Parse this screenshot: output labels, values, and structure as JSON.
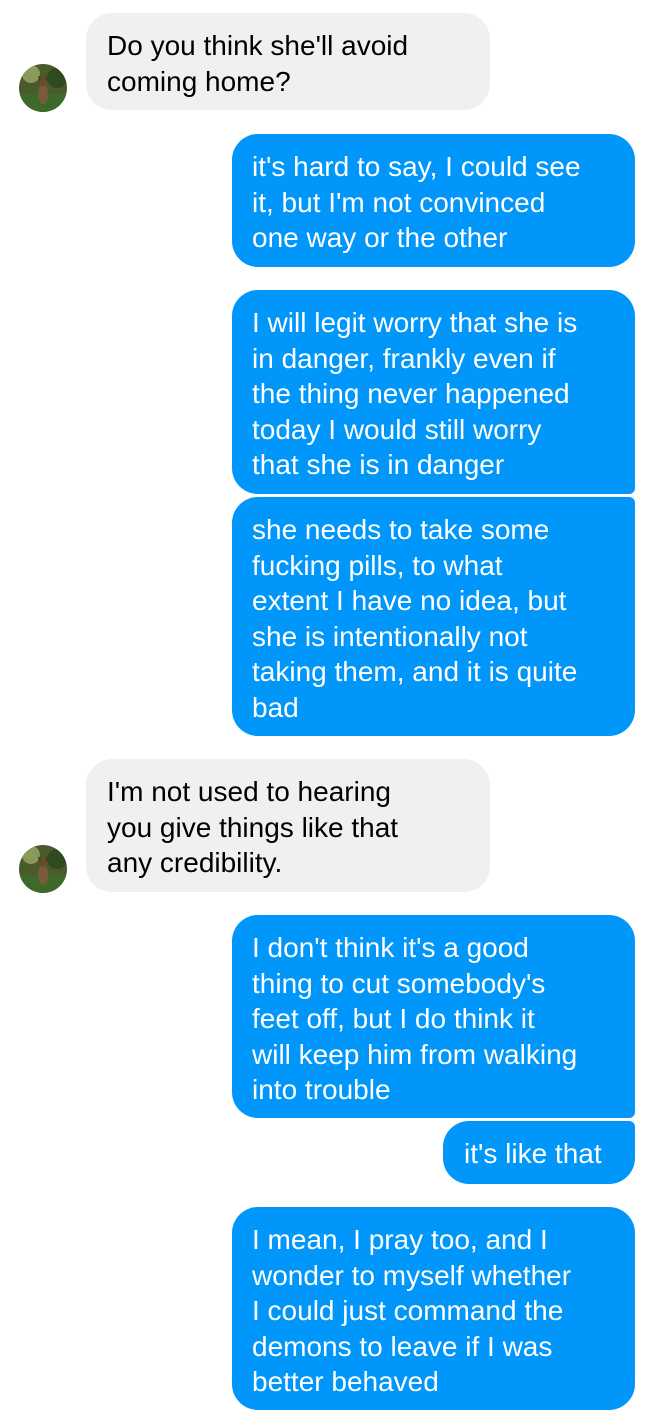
{
  "conversation": {
    "messages": [
      {
        "sender": "contact",
        "text": "Do you think she'll avoid\ncoming home?"
      },
      {
        "sender": "me",
        "text": "it's hard to say, I could see\nit, but I'm not convinced\none way or the other"
      },
      {
        "sender": "me",
        "text": "I will legit worry that she is\nin danger, frankly even if\nthe thing never happened\ntoday I would still worry\nthat she is in danger"
      },
      {
        "sender": "me",
        "text": "she needs to take some\nfucking pills, to what\nextent I have no idea, but\nshe is intentionally not\ntaking them, and it is quite\nbad"
      },
      {
        "sender": "contact",
        "text": "I'm not used to hearing\nyou give things like that\nany credibility."
      },
      {
        "sender": "me",
        "text": "I don't think it's a good\nthing to cut somebody's\nfeet off, but I do think it\nwill keep him from walking\ninto trouble"
      },
      {
        "sender": "me",
        "text": "it's like that"
      },
      {
        "sender": "me",
        "text": "I mean, I pray too, and I\nwonder to myself whether\nI could just command the\ndemons to leave if I was\nbetter behaved"
      }
    ]
  },
  "colors": {
    "outgoing_bubble": "#0096fa",
    "incoming_bubble": "#f1f0f0",
    "outgoing_text": "#ffffff",
    "incoming_text": "#000000"
  },
  "icons": {
    "avatar": "contact-avatar-photo"
  }
}
